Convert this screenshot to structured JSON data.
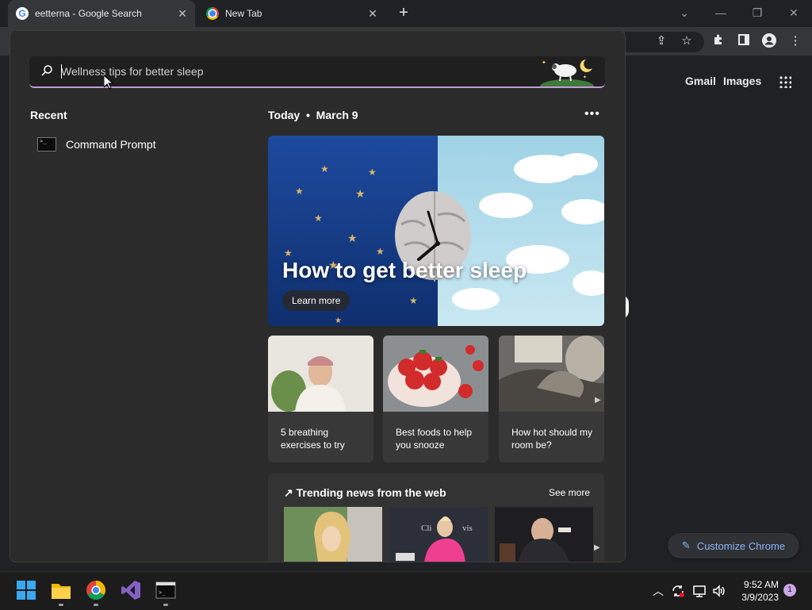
{
  "browser": {
    "tabs": [
      {
        "title": "eetterna - Google Search",
        "favicon": "google-icon"
      },
      {
        "title": "New Tab",
        "favicon": "chrome-icon"
      }
    ],
    "new_tab_label": "+",
    "page_links": {
      "gmail": "Gmail",
      "images": "Images"
    },
    "customize_label": "Customize Chrome"
  },
  "search_flyout": {
    "query_placeholder": "Wellness tips for better sleep",
    "recent_title": "Recent",
    "recent_items": [
      {
        "label": "Command Prompt",
        "icon": "command-prompt-icon"
      }
    ],
    "today_label": "Today",
    "date": "March 9",
    "hero": {
      "title": "How to get better sleep",
      "button": "Learn more"
    },
    "cards": [
      {
        "text": "5 breathing exercises to try"
      },
      {
        "text": "Best foods to help you snooze"
      },
      {
        "text": "How hot should my room be?"
      }
    ],
    "trending": {
      "title": "Trending news from the web",
      "see_more": "See more"
    }
  },
  "taskbar": {
    "apps": [
      "start-icon",
      "file-explorer-icon",
      "chrome-icon",
      "visual-studio-icon",
      "terminal-icon"
    ],
    "time": "9:52 AM",
    "date": "3/9/2023",
    "notification_count": "1"
  },
  "colors": {
    "accent": "#c39ad8",
    "link": "#8ab4f8",
    "flyout_bg": "#2b2b2b"
  }
}
